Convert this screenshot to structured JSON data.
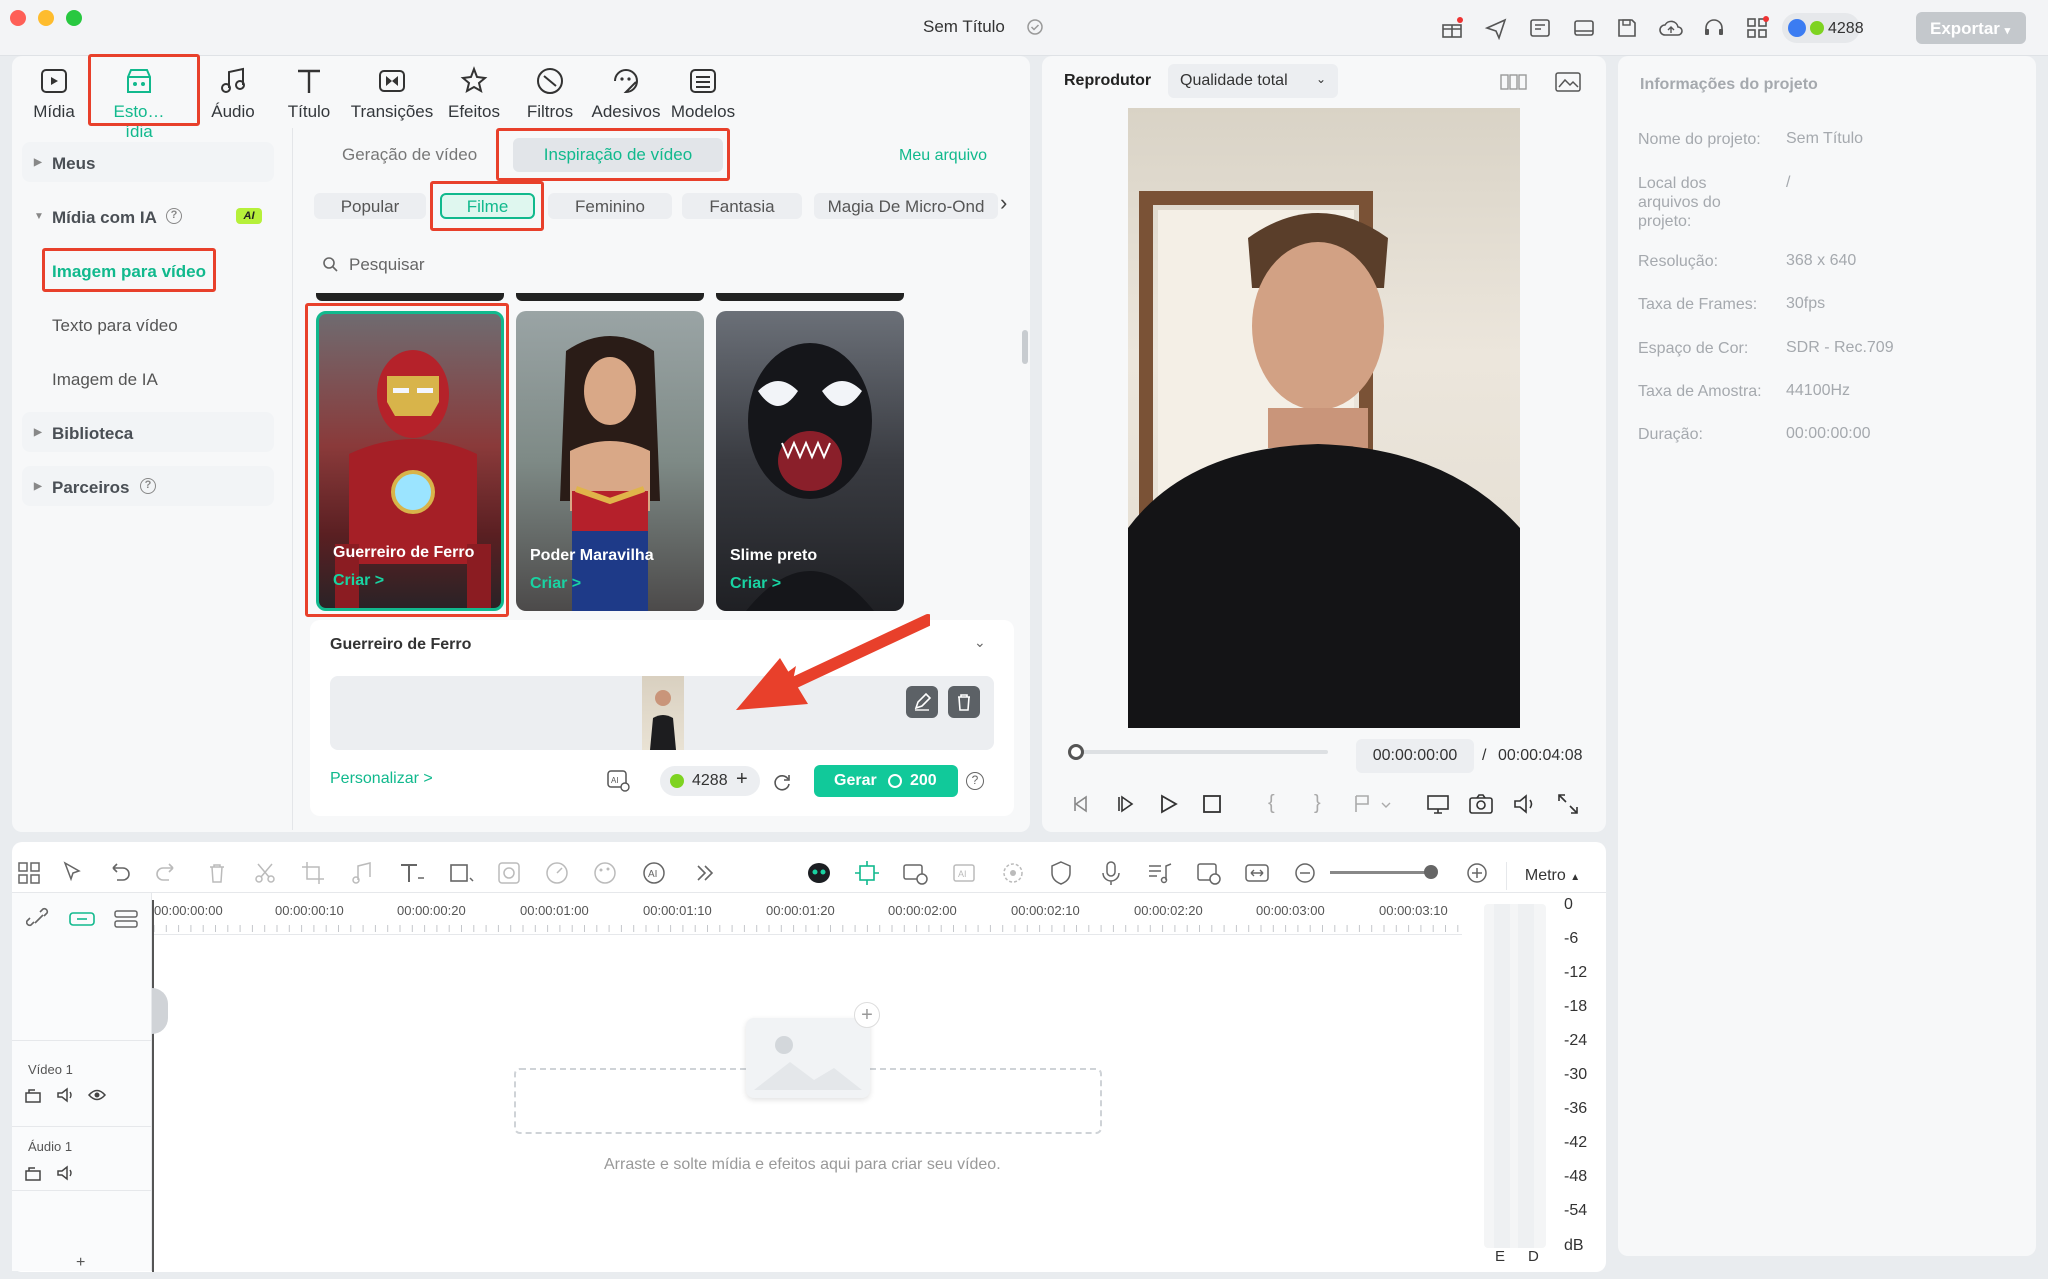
{
  "window": {
    "title": "Sem Título",
    "credits": "4288",
    "export_label": "Exportar"
  },
  "toolbar": {
    "tabs": [
      {
        "label": "Mídia"
      },
      {
        "label": "Esto…ídia"
      },
      {
        "label": "Áudio"
      },
      {
        "label": "Título"
      },
      {
        "label": "Transições"
      },
      {
        "label": "Efeitos"
      },
      {
        "label": "Filtros"
      },
      {
        "label": "Adesivos"
      },
      {
        "label": "Modelos"
      }
    ]
  },
  "sidebar": {
    "meus": "Meus",
    "midia_ia": "Mídia com IA",
    "ai_badge": "AI",
    "items": [
      "Imagem para vídeo",
      "Texto para vídeo",
      "Imagem de IA"
    ],
    "biblioteca": "Biblioteca",
    "parceiros": "Parceiros"
  },
  "content": {
    "tab_gen": "Geração de vídeo",
    "tab_insp": "Inspiração de vídeo",
    "my_file": "Meu arquivo",
    "chips": [
      "Popular",
      "Filme",
      "Feminino",
      "Fantasia",
      "Magia De Micro-Ond"
    ],
    "search_placeholder": "Pesquisar",
    "cards": [
      {
        "title": "Guerreiro de Ferro",
        "cta": "Criar >"
      },
      {
        "title": "Poder Maravilha",
        "cta": "Criar >"
      },
      {
        "title": "Slime preto",
        "cta": "Criar >"
      }
    ],
    "selected_title": "Guerreiro de Ferro",
    "customize": "Personalizar >",
    "credits": "4288",
    "generate": "Gerar",
    "generate_cost": "200"
  },
  "player": {
    "label": "Reprodutor",
    "quality": "Qualidade total",
    "time_current": "00:00:00:00",
    "time_sep": "/",
    "time_total": "00:00:04:08"
  },
  "info": {
    "title": "Informações do projeto",
    "rows": [
      {
        "label": "Nome do projeto:",
        "value": "Sem Título"
      },
      {
        "label": "Local dos arquivos do projeto:",
        "value": "/"
      },
      {
        "label": "Resolução:",
        "value": "368 x 640"
      },
      {
        "label": "Taxa de Frames:",
        "value": "30fps"
      },
      {
        "label": "Espaço de Cor:",
        "value": "SDR - Rec.709"
      },
      {
        "label": "Taxa de Amostra:",
        "value": "44100Hz"
      },
      {
        "label": "Duração:",
        "value": "00:00:00:00"
      }
    ]
  },
  "timeline": {
    "meter_label": "Metro",
    "ruler": [
      "00:00:00:00",
      "00:00:00:10",
      "00:00:00:20",
      "00:00:01:00",
      "00:00:01:10",
      "00:00:01:20",
      "00:00:02:00",
      "00:00:02:10",
      "00:00:02:20",
      "00:00:03:00",
      "00:00:03:10"
    ],
    "video_track": "Vídeo 1",
    "audio_track": "Áudio 1",
    "drop_hint": "Arraste e solte mídia e efeitos aqui para criar seu vídeo.",
    "db_scale": [
      "0",
      "-6",
      "-12",
      "-18",
      "-24",
      "-30",
      "-36",
      "-42",
      "-48",
      "-54",
      "dB"
    ],
    "channels": [
      "E",
      "D"
    ],
    "add": "+"
  }
}
